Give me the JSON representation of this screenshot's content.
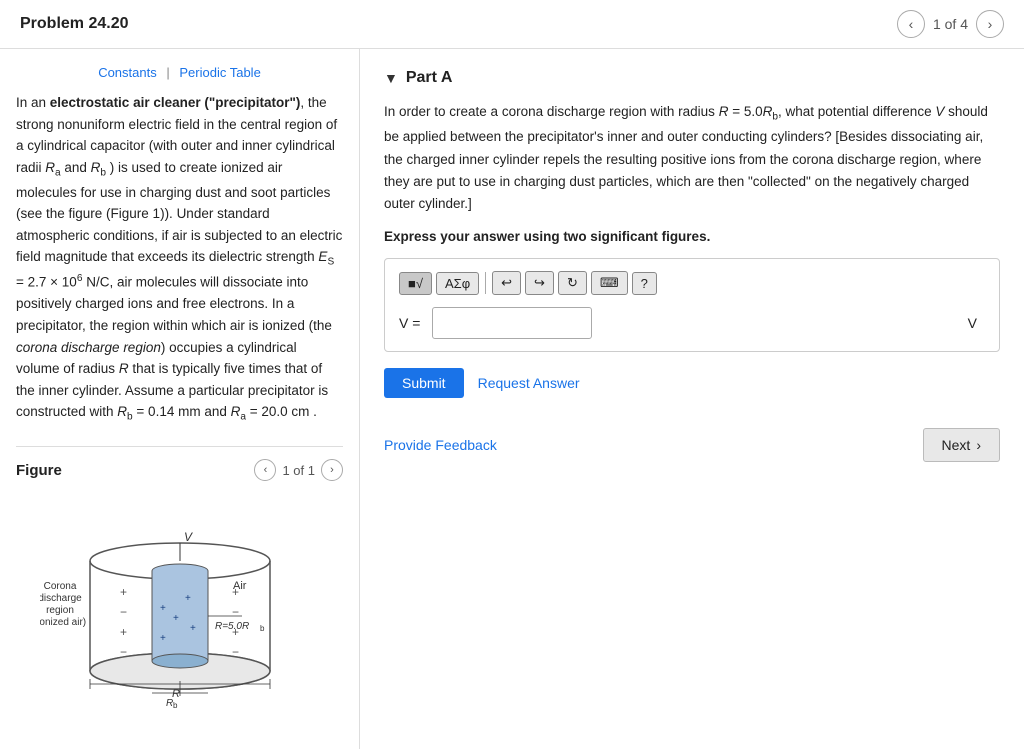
{
  "header": {
    "title": "Problem 24.20",
    "nav_current": "1 of 4",
    "prev_label": "<",
    "next_label": ">"
  },
  "left_panel": {
    "links": {
      "constants": "Constants",
      "periodic_table": "Periodic Table",
      "separator": "|"
    },
    "body_paragraphs": [
      "In an electrostatic air cleaner (\"precipitator\"), the strong nonuniform electric field in the central region of a cylindrical capacitor (with outer and inner cylindrical radii R_a and R_b) is used to create ionized air molecules for use in charging dust and soot particles (see the figure (Figure 1)). Under standard atmospheric conditions, if air is subjected to an electric field magnitude that exceeds its dielectric strength E_S = 2.7 × 10⁶ N/C, air molecules will dissociate into positively charged ions and free electrons. In a precipitator, the region within which air is ionized (the corona discharge region) occupies a cylindrical volume of radius R that is typically five times that of the inner cylinder. Assume a particular precipitator is constructed with R_b = 0.14 mm and R_a = 20.0 cm ."
    ],
    "figure_title": "Figure",
    "figure_nav": "1 of 1",
    "figure_labels": {
      "corona_discharge": "Corona\ndischarge\nregion\n(ionized air)",
      "air": "Air",
      "r_formula": "R=5.0R_b",
      "r_b_label": "R_b",
      "r_label": "R",
      "v_label": "V"
    }
  },
  "right_panel": {
    "part_label": "Part A",
    "description": "In order to create a corona discharge region with radius R = 5.0R_b, what potential difference V should be applied between the precipitator's inner and outer conducting cylinders? [Besides dissociating air, the charged inner cylinder repels the resulting positive ions from the corona discharge region, where they are put to use in charging dust particles, which are then \"collected\" on the negatively charged outer cylinder.]",
    "express_label": "Express your answer using two significant figures.",
    "toolbar": {
      "matrix_btn": "🔲√",
      "symbol_btn": "ΑΣφ",
      "undo_btn": "↩",
      "redo_btn": "↪",
      "refresh_btn": "↻",
      "keyboard_btn": "⌨",
      "help_btn": "?"
    },
    "input": {
      "eq_label": "V =",
      "placeholder": "",
      "unit": "V"
    },
    "submit_label": "Submit",
    "request_answer_label": "Request Answer",
    "provide_feedback_label": "Provide Feedback",
    "next_label": "Next"
  }
}
